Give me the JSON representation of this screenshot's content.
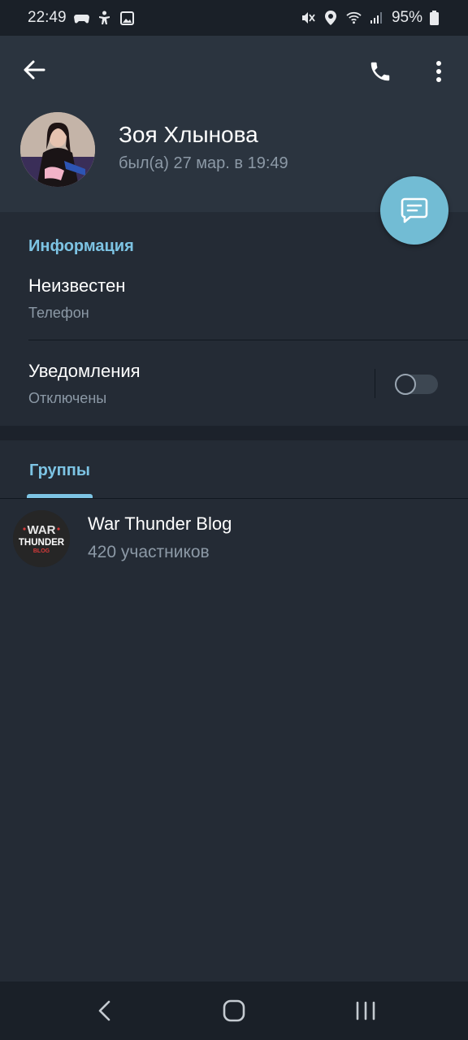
{
  "status_bar": {
    "time": "22:49",
    "battery": "95%",
    "icons_left": [
      "game-controller-icon",
      "accessibility-icon",
      "gallery-icon"
    ],
    "icons_right": [
      "mute-icon",
      "location-icon",
      "wifi-icon",
      "signal-icon",
      "battery-icon"
    ]
  },
  "header": {
    "back_icon": "arrow-left-icon",
    "call_icon": "phone-icon",
    "more_icon": "more-vertical-icon",
    "name": "Зоя Хлынова",
    "last_seen": "был(а) 27 мар. в 19:49",
    "fab_icon": "message-icon"
  },
  "info": {
    "title": "Информация",
    "phone_value": "Неизвестен",
    "phone_label": "Телефон",
    "notifications_title": "Уведомления",
    "notifications_state": "Отключены",
    "notifications_enabled": false
  },
  "groups": {
    "tab_label": "Группы",
    "items": [
      {
        "name": "War Thunder Blog",
        "members": "420 участников",
        "logo_text": [
          "WAR",
          "THUNDER",
          "BLOG"
        ]
      }
    ]
  },
  "nav_bar": {
    "icons": [
      "back-nav-icon",
      "home-nav-icon",
      "recents-nav-icon"
    ]
  },
  "colors": {
    "accent": "#7dc4e4",
    "fab": "#72bcd4",
    "header_bg": "#2b343f",
    "body_bg": "#242b35",
    "secondary_text": "#8c99a6"
  }
}
